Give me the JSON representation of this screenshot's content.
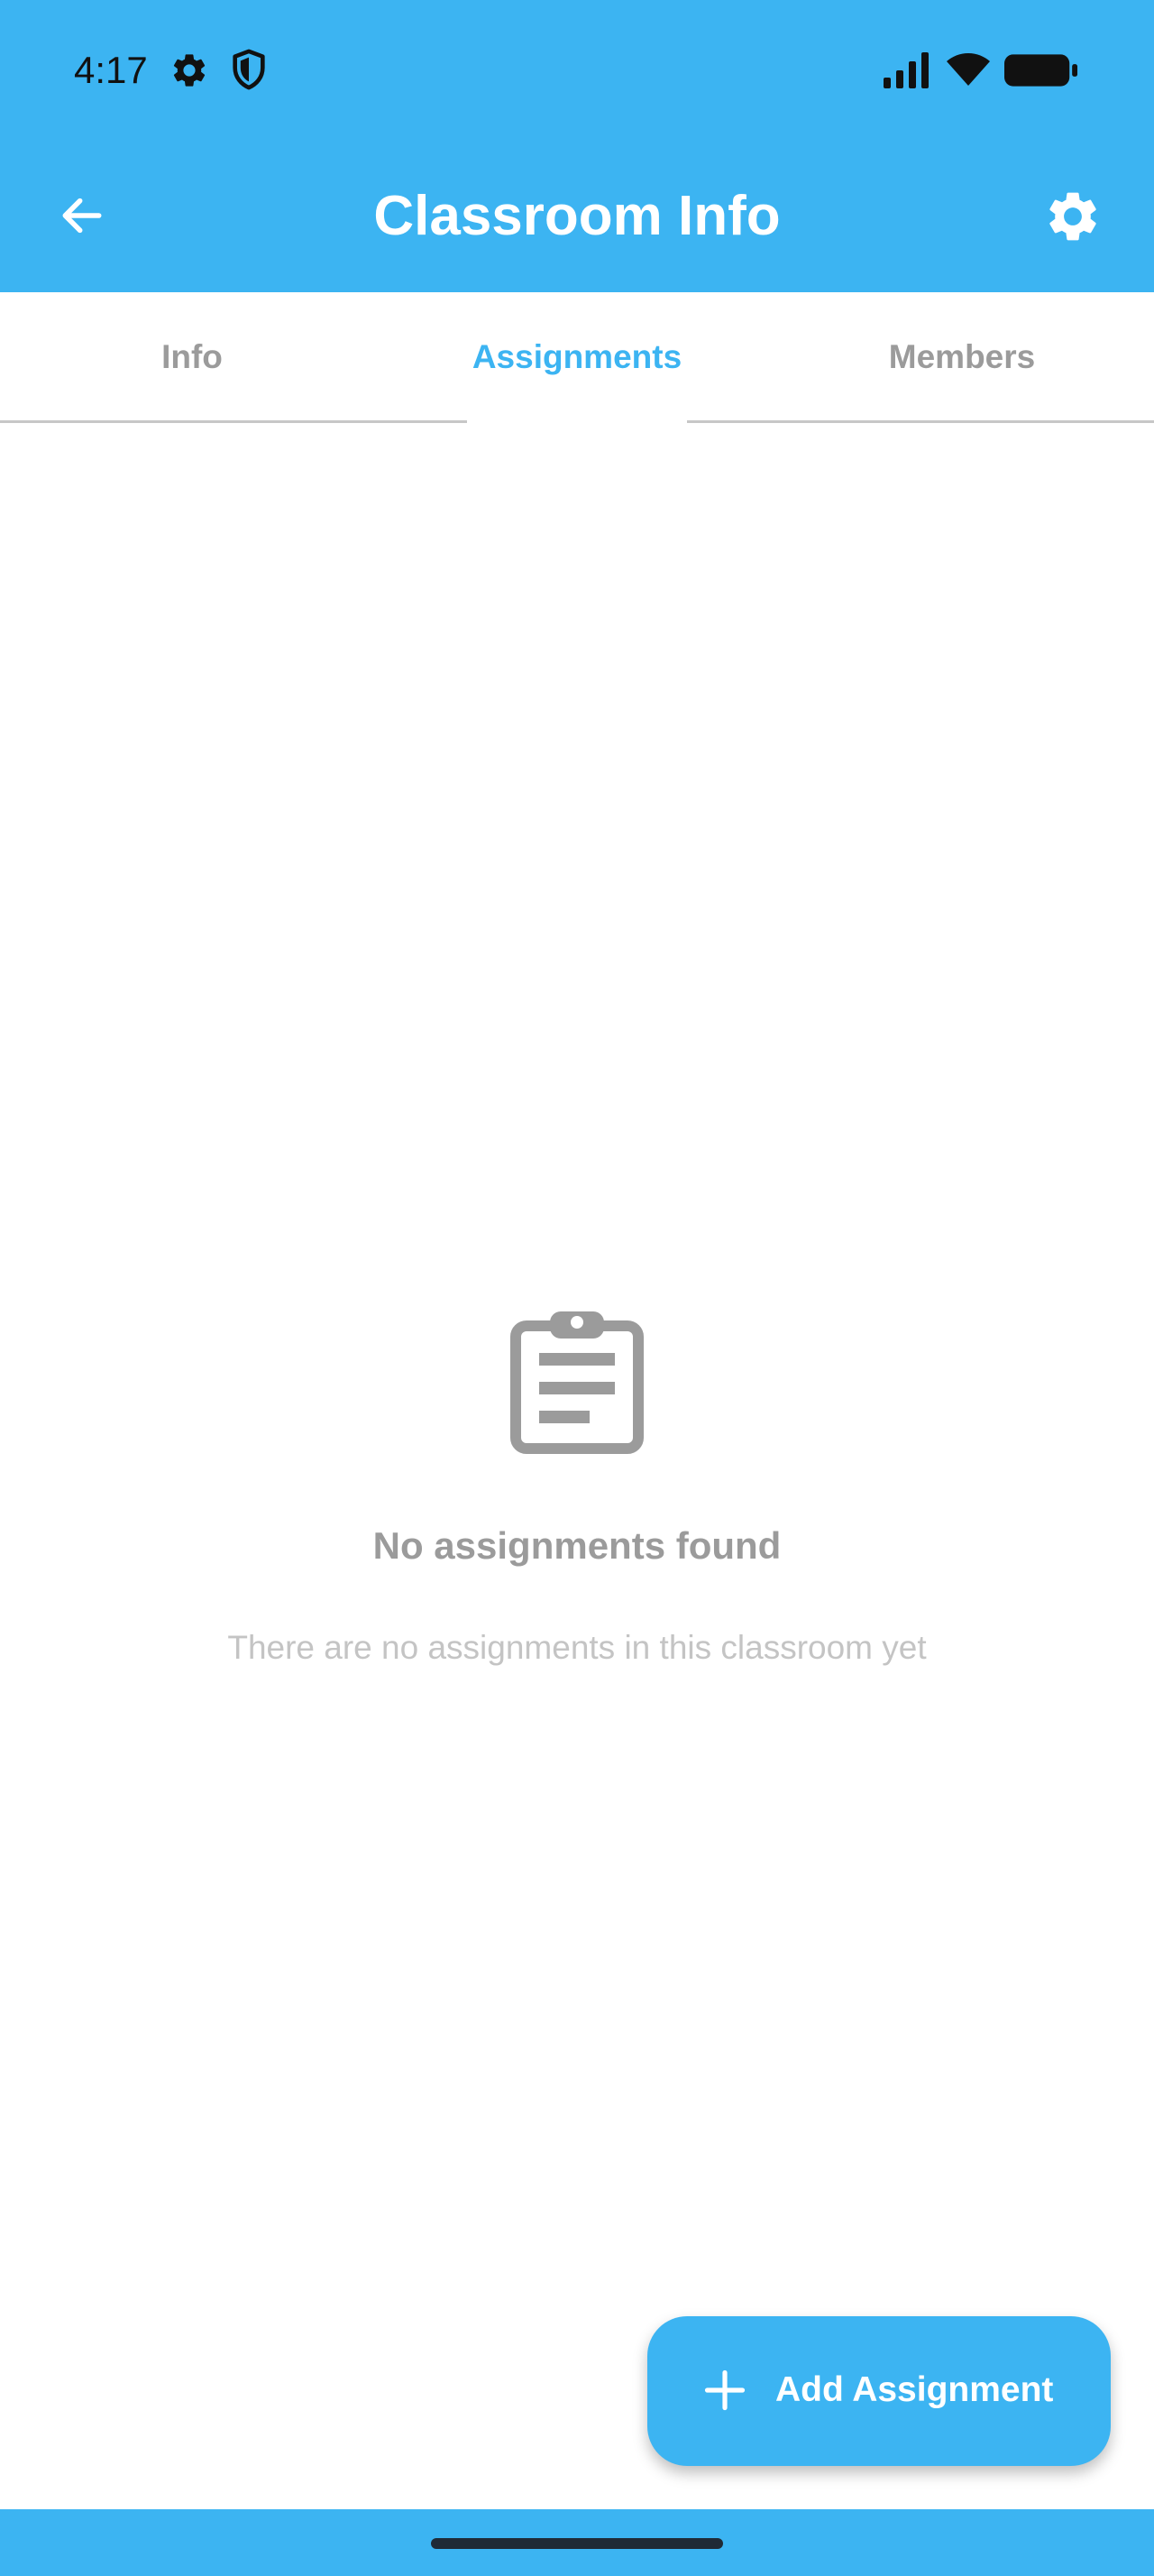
{
  "status_bar": {
    "time": "4:17",
    "icons": [
      "gear-icon",
      "shield-icon",
      "signal-icon",
      "wifi-icon",
      "battery-icon"
    ]
  },
  "header": {
    "title": "Classroom Info",
    "back_icon": "arrow-left-icon",
    "settings_icon": "gear-icon"
  },
  "tabs": [
    {
      "label": "Info",
      "active": false
    },
    {
      "label": "Assignments",
      "active": true
    },
    {
      "label": "Members",
      "active": false
    }
  ],
  "empty_state": {
    "icon": "clipboard-icon",
    "title": "No assignments found",
    "subtitle": "There are no assignments in this classroom yet"
  },
  "fab": {
    "icon": "plus-icon",
    "label": "Add Assignment"
  },
  "colors": {
    "primary": "#3CB4F2",
    "inactive_tab": "#9b9b9b",
    "empty_title": "#9b9b9b",
    "empty_subtitle": "#c4c4c4"
  }
}
